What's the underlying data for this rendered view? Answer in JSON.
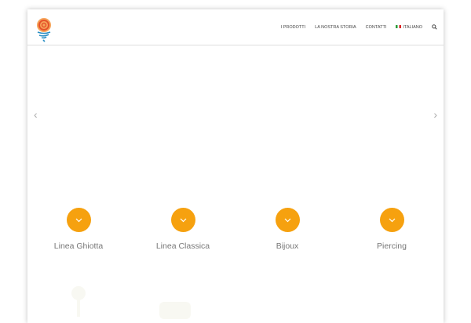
{
  "nav": {
    "items": [
      "I PRODOTTI",
      "LA NOSTRA STORIA",
      "CONTATTI"
    ],
    "language": "ITALIANO"
  },
  "categories": [
    {
      "label": "Linea Ghiotta"
    },
    {
      "label": "Linea Classica"
    },
    {
      "label": "Bijoux"
    },
    {
      "label": "Piercing"
    }
  ],
  "colors": {
    "accent": "#f6a10f"
  }
}
